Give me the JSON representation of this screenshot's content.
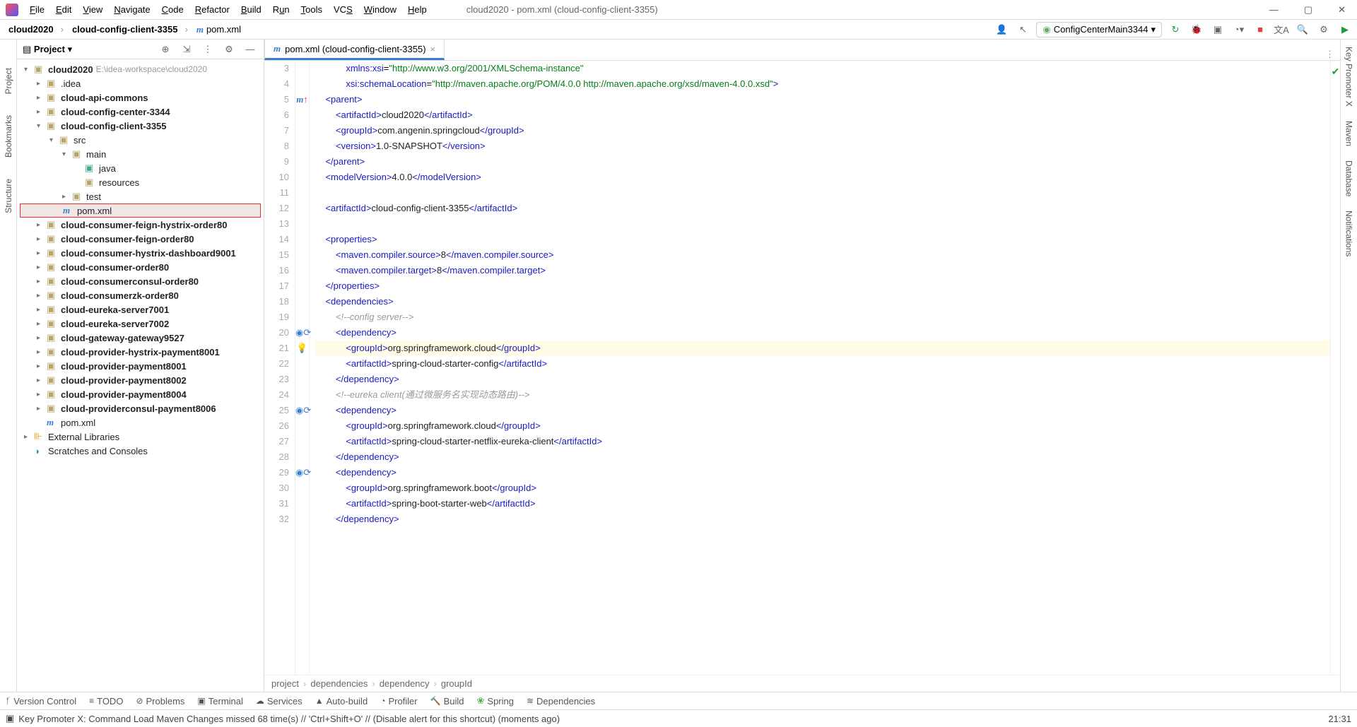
{
  "window": {
    "title": "cloud2020 - pom.xml (cloud-config-client-3355)",
    "min": "—",
    "max": "▢",
    "close": "✕"
  },
  "menu": [
    "File",
    "Edit",
    "View",
    "Navigate",
    "Code",
    "Refactor",
    "Build",
    "Run",
    "Tools",
    "VCS",
    "Window",
    "Help"
  ],
  "breadcrumbs": {
    "a": "cloud2020",
    "b": "cloud-config-client-3355",
    "c": "pom.xml"
  },
  "runConfig": "ConfigCenterMain3344",
  "project": {
    "header": "Project",
    "root": "cloud2020",
    "rootPath": "E:\\idea-workspace\\cloud2020",
    "items": [
      ".idea",
      "cloud-api-commons",
      "cloud-config-center-3344",
      "cloud-config-client-3355",
      "src",
      "main",
      "java",
      "resources",
      "test",
      "pom.xml",
      "cloud-consumer-feign-hystrix-order80",
      "cloud-consumer-feign-order80",
      "cloud-consumer-hystrix-dashboard9001",
      "cloud-consumer-order80",
      "cloud-consumerconsul-order80",
      "cloud-consumerzk-order80",
      "cloud-eureka-server7001",
      "cloud-eureka-server7002",
      "cloud-gateway-gateway9527",
      "cloud-provider-hystrix-payment8001",
      "cloud-provider-payment8001",
      "cloud-provider-payment8002",
      "cloud-provider-payment8004",
      "cloud-providerconsul-payment8006",
      "pom.xml",
      "External Libraries",
      "Scratches and Consoles"
    ]
  },
  "tab": "pom.xml (cloud-config-client-3355)",
  "lines": {
    "start": 3,
    "end": 32
  },
  "codeVals": {
    "xsiUrl": "\"http://www.w3.org/2001/XMLSchema-instance\"",
    "schemaLoc": "\"http://maven.apache.org/POM/4.0.0 http://maven.apache.org/xsd/maven-4.0.0.xsd\"",
    "parentArtifact": "cloud2020",
    "parentGroup": "com.angenin.springcloud",
    "parentVersion": "1.0-SNAPSHOT",
    "modelVersion": "4.0.0",
    "artifactId": "cloud-config-client-3355",
    "compilerSource": "8",
    "compilerTarget": "8",
    "comment1": "config server",
    "dep1Group": "org.springframework.cloud",
    "dep1Artifact": "spring-cloud-starter-config",
    "comment2": "eureka client(通过微服务名实现动态路由)",
    "dep2Group": "org.springframework.cloud",
    "dep2Artifact": "spring-cloud-starter-netflix-eureka-client",
    "dep3Group": "org.springframework.boot",
    "dep3Artifact": "spring-boot-starter-web"
  },
  "editorBreadcrumb": [
    "project",
    "dependencies",
    "dependency",
    "groupId"
  ],
  "toolWindows": [
    "Version Control",
    "TODO",
    "Problems",
    "Terminal",
    "Services",
    "Auto-build",
    "Profiler",
    "Build",
    "Spring",
    "Dependencies"
  ],
  "status": {
    "msg": "Key Promoter X: Command Load Maven Changes missed 68 time(s) // 'Ctrl+Shift+O' // (Disable alert for this shortcut) (moments ago)",
    "pos": "21:31"
  },
  "leftTabs": [
    "Project",
    "Bookmarks",
    "Structure"
  ],
  "rightTabs": [
    "Key Promoter X",
    "Maven",
    "Database",
    "Notifications"
  ]
}
